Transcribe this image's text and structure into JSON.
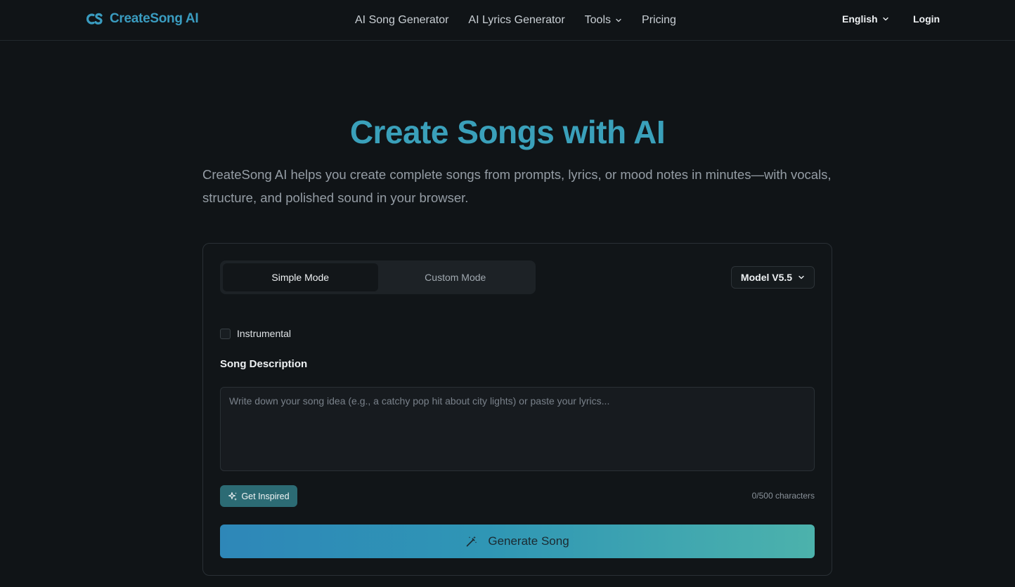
{
  "header": {
    "logo_text": "CreateSong AI",
    "nav": [
      "AI Song Generator",
      "AI Lyrics Generator",
      "Tools",
      "Pricing"
    ],
    "language": "English",
    "login": "Login"
  },
  "hero": {
    "title": "Create Songs with AI",
    "subtitle": "CreateSong AI helps you create complete songs from prompts, lyrics, or mood notes in minutes—with vocals, structure, and polished sound in your browser."
  },
  "form": {
    "modes": [
      "Simple Mode",
      "Custom Mode"
    ],
    "active_mode": "Simple Mode",
    "model": "Model V5.5",
    "instrumental_label": "Instrumental",
    "instrumental_checked": false,
    "description_label": "Song Description",
    "description_value": "",
    "description_placeholder": "Write down your song idea (e.g., a catchy pop hit about city lights) or paste your lyrics...",
    "inspire_label": "Get Inspired",
    "counter": "0/500 characters",
    "generate_label": "Generate Song"
  },
  "icons": {
    "logo": "cs-logo-icon",
    "dropdown": "chevron-down-icon",
    "inspire": "sparkles-icon",
    "generate": "magic-wand-icon"
  },
  "colors": {
    "background": "#101417",
    "accent": "#3aa0ba",
    "gradient_start": "#2e87b8",
    "gradient_end": "#4cb2ac"
  }
}
